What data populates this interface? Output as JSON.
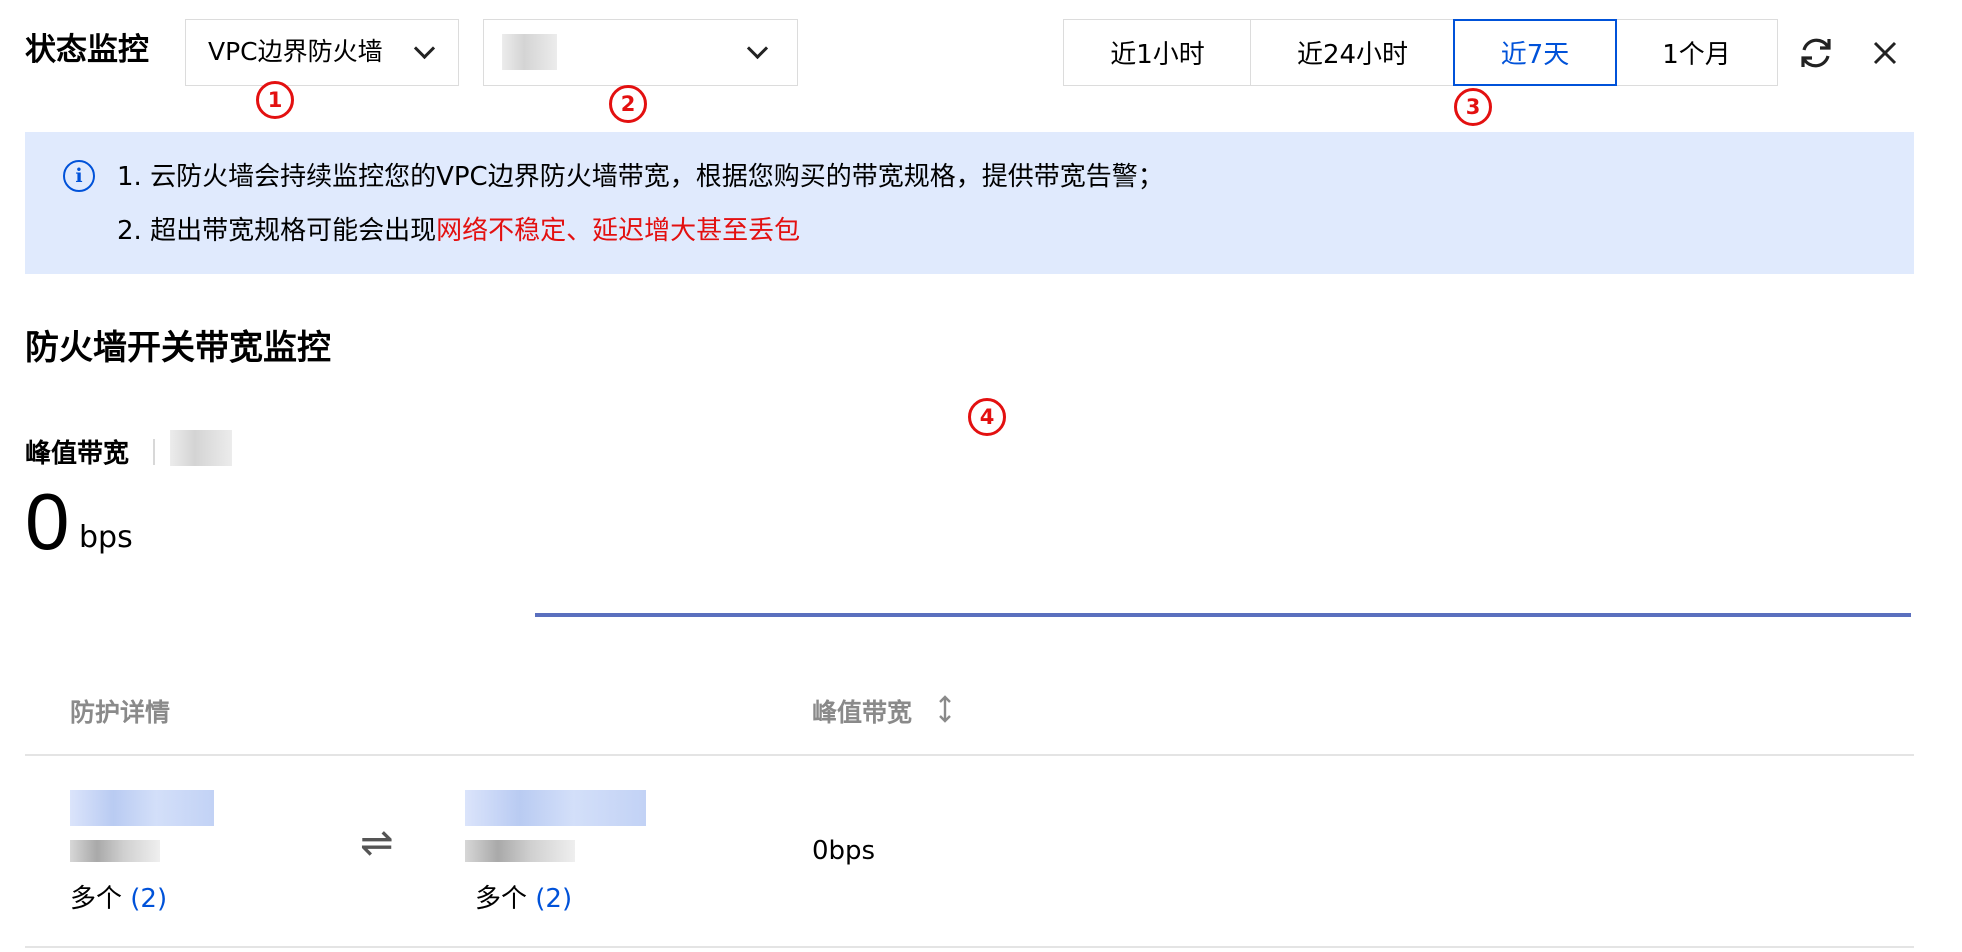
{
  "header": {
    "title": "状态监控",
    "firewall_select": "VPC边界防火墙",
    "instance_select": "",
    "time_ranges": [
      {
        "label": "近1小时",
        "active": false
      },
      {
        "label": "近24小时",
        "active": false
      },
      {
        "label": "近7天",
        "active": true
      },
      {
        "label": "1个月",
        "active": false
      }
    ]
  },
  "markers": [
    "1",
    "2",
    "3",
    "4"
  ],
  "notice": {
    "line1": "1. 云防火墙会持续监控您的VPC边界防火墙带宽，根据您购买的带宽规格，提供带宽告警；",
    "line2_prefix": "2. 超出带宽规格可能会出现",
    "line2_highlight": "网络不稳定、延迟增大甚至丢包"
  },
  "monitor": {
    "section_title": "防火墙开关带宽监控",
    "peak_label": "峰值带宽",
    "peak_value": "0",
    "peak_unit": "bps"
  },
  "table": {
    "columns": [
      "防护详情",
      "峰值带宽"
    ],
    "rows": [
      {
        "source_multi": "多个",
        "source_count": "(2)",
        "dest_multi": "多个",
        "dest_count": "(2)",
        "peak": "0bps"
      }
    ]
  },
  "colors": {
    "accent": "#0052d9",
    "highlight_red": "#e31010",
    "notice_bg": "#e0eafd",
    "chart_line": "#5a6fbe"
  },
  "icons": [
    "chevron-down-icon",
    "refresh-icon",
    "close-icon",
    "info-icon",
    "sort-icon",
    "swap-arrows-icon"
  ]
}
